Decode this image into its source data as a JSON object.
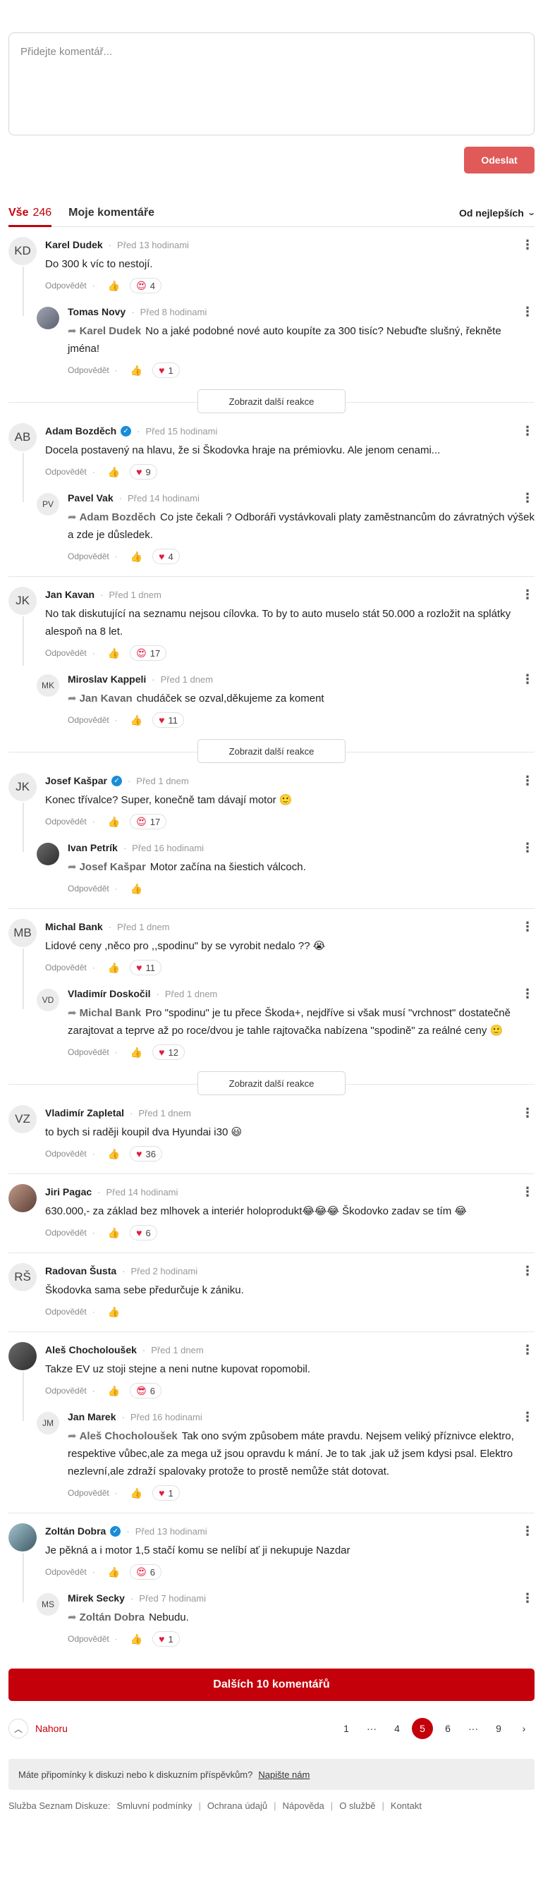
{
  "composer": {
    "placeholder": "Přidejte komentář...",
    "send_label": "Odeslat"
  },
  "tabs": {
    "all_label": "Vše",
    "all_count": "246",
    "mine_label": "Moje komentáře",
    "sort_label": "Od nejlepších"
  },
  "labels": {
    "reply": "Odpovědět",
    "more_replies": "Zobrazit další reakce",
    "more_comments": "Dalších 10 komentářů",
    "to_top": "Nahoru"
  },
  "threads": [
    {
      "initials": "KD",
      "name": "Karel Dudek",
      "time": "Před 13 hodinami",
      "text": "Do 300 k víc to nestojí.",
      "react_icon": "😍",
      "react_count": "4",
      "reply": {
        "initials": "",
        "name": "Tomas Novy",
        "time": "Před 8 hodinami",
        "mention": "Karel Dudek",
        "text": "No a jaké podobné nové auto koupíte za 300 tisíc? Nebuďte slušný, řekněte jména!",
        "react_icon": "♥",
        "react_count": "1"
      }
    },
    {
      "initials": "AB",
      "name": "Adam Bozděch",
      "time": "Před 15 hodinami",
      "text": "Docela postavený na hlavu, že si Škodovka hraje na prémiovku. Ale jenom cenami...",
      "react_icon": "♥",
      "react_count": "9",
      "reply": {
        "initials": "PV",
        "name": "Pavel Vak",
        "time": "Před 14 hodinami",
        "mention": "Adam Bozděch",
        "text": "Co jste čekali ? Odboráři vystávkovali platy zaměstnancům do závratných výšek a zde je důsledek.",
        "react_icon": "♥",
        "react_count": "4"
      }
    },
    {
      "initials": "JK",
      "name": "Jan Kavan",
      "time": "Před 1 dnem",
      "text": "No tak diskutující na seznamu nejsou cílovka. To by to auto muselo stát 50.000 a rozložit na splátky alespoň na 8 let.",
      "react_icon": "😍",
      "react_count": "17",
      "reply": {
        "initials": "MK",
        "name": "Miroslav Kappeli",
        "time": "Před 1 dnem",
        "mention": "Jan Kavan",
        "text": "chudáček se ozval,děkujeme za koment",
        "react_icon": "♥",
        "react_count": "11"
      }
    },
    {
      "initials": "JK",
      "name": "Josef Kašpar",
      "time": "Před 1 dnem",
      "text": "Konec třívalce? Super, konečně tam dávají motor 🙂",
      "react_icon": "😍",
      "react_count": "17",
      "reply": {
        "initials": "",
        "name": "Ivan Petrík",
        "time": "Před 16 hodinami",
        "mention": "Josef Kašpar",
        "text": "Motor začína na šiestich válcoch.",
        "react_icon": "",
        "react_count": ""
      }
    },
    {
      "initials": "MB",
      "name": "Michal Bank",
      "time": "Před 1 dnem",
      "text": "Lidové ceny ,něco pro ,,spodinu\" by se vyrobit nedalo ?? 😭",
      "react_icon": "♥",
      "react_count": "11",
      "reply": {
        "initials": "VD",
        "name": "Vladimír Doskočil",
        "time": "Před 1 dnem",
        "mention": "Michal Bank",
        "text": "Pro \"spodinu\" je tu přece Škoda+, nejdříve si však musí \"vrchnost\" dostatečně zarajtovat a teprve až po roce/dvou je tahle rajtovačka nabízena \"spodině\" za reálné ceny 🙂",
        "react_icon": "♥",
        "react_count": "12"
      }
    },
    {
      "initials": "VZ",
      "name": "Vladimír Zapletal",
      "time": "Před 1 dnem",
      "text": "to bych si raději koupil dva Hyundai i30 😃",
      "react_icon": "♥",
      "react_count": "36"
    },
    {
      "initials": "",
      "name": "Jiri Pagac",
      "time": "Před 14 hodinami",
      "text": "630.000,- za základ bez mlhovek a interiér holoprodukt😂😂😂 Škodovko zadav se tím 😂",
      "react_icon": "♥",
      "react_count": "6"
    },
    {
      "initials": "RŠ",
      "name": "Radovan Šusta",
      "time": "Před 2 hodinami",
      "text": "Škodovka sama sebe předurčuje k zániku.",
      "react_icon": "",
      "react_count": ""
    },
    {
      "initials": "",
      "name": "Aleš Chocholoušek",
      "time": "Před 1 dnem",
      "text": "Takze EV uz stoji stejne a neni nutne kupovat ropomobil.",
      "react_icon": "😎",
      "react_count": "6",
      "reply": {
        "initials": "JM",
        "name": "Jan Marek",
        "time": "Před 16 hodinami",
        "mention": "Aleš Chocholoušek",
        "text": "Tak ono svým způsobem máte pravdu. Nejsem veliký příznivce elektro, respektive vůbec,ale za mega už jsou opravdu k mání. Je to tak ,jak už jsem kdysi psal. Elektro nezlevní,ale zdraží spalovaky protože to prostě nemůže stát dotovat.",
        "react_icon": "♥",
        "react_count": "1"
      }
    },
    {
      "initials": "",
      "name": "Zoltán Dobra",
      "time": "Před 13 hodinami",
      "text": "Je pěkná a i motor 1,5 stačí komu se nelíbí ať ji nekupuje Nazdar",
      "react_icon": "😍",
      "react_count": "6",
      "reply": {
        "initials": "MS",
        "name": "Mirek Secky",
        "time": "Před 7 hodinami",
        "mention": "Zoltán Dobra",
        "text": "Nebudu.",
        "react_icon": "♥",
        "react_count": "1"
      }
    }
  ],
  "pager": {
    "p1": "1",
    "dots": "···",
    "p4": "4",
    "p5": "5",
    "p6": "6",
    "p9": "9"
  },
  "feedback": {
    "text": "Máte připomínky k diskuzi nebo k diskuzním příspěvkům?",
    "link": "Napište nám"
  },
  "footer": {
    "title": "Služba Seznam Diskuze:",
    "links": [
      "Smluvní podmínky",
      "Ochrana údajů",
      "Nápověda",
      "O službě",
      "Kontakt"
    ]
  },
  "colors": {
    "accent": "#c4000a",
    "send_button": "#e05a5a",
    "verified": "#1a8cd8"
  }
}
